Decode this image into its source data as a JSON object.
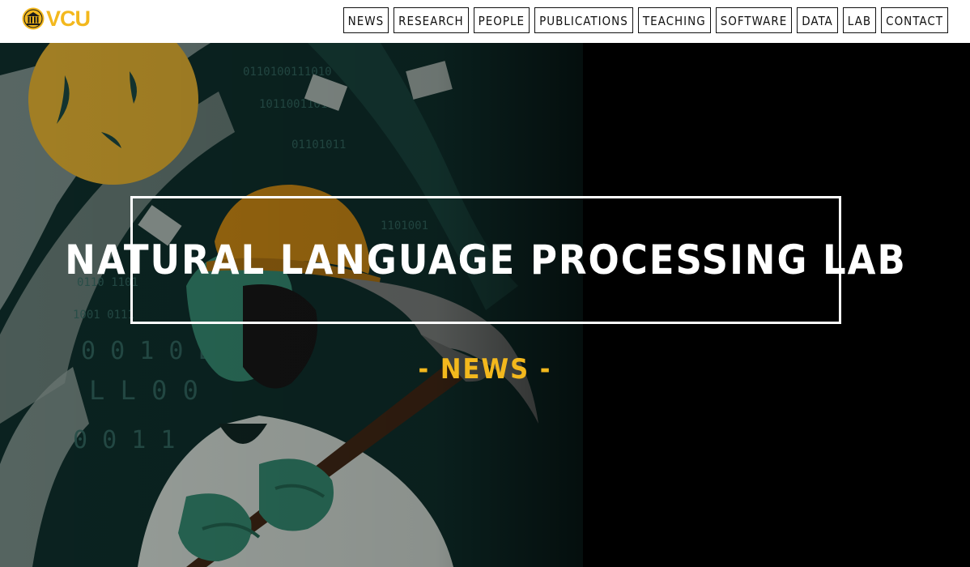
{
  "brand": {
    "logo_text": "VCU",
    "seal_icon": "vcu-seal-icon",
    "accent": "#f3b81d"
  },
  "nav": {
    "items": [
      {
        "label": "NEWS"
      },
      {
        "label": "RESEARCH"
      },
      {
        "label": "PEOPLE"
      },
      {
        "label": "PUBLICATIONS"
      },
      {
        "label": "TEACHING"
      },
      {
        "label": "SOFTWARE"
      },
      {
        "label": "DATA"
      },
      {
        "label": "LAB"
      },
      {
        "label": "CONTACT"
      }
    ]
  },
  "hero": {
    "title": "NATURAL LANGUAGE PROCESSING LAB",
    "subtitle": "- NEWS -",
    "illustration": "scientist-with-pickaxe-illustration"
  }
}
